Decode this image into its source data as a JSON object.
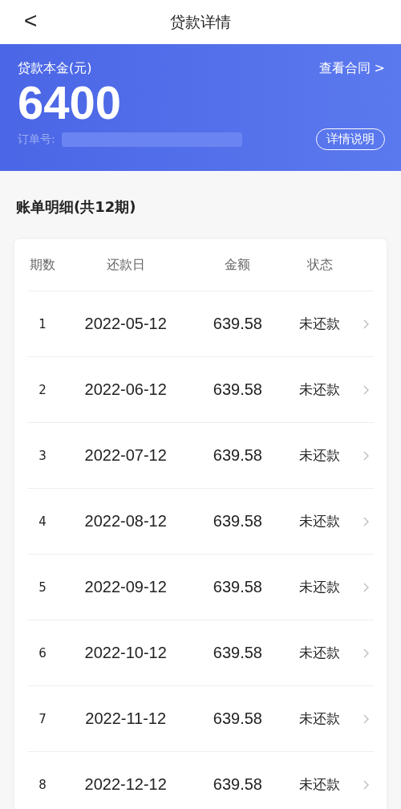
{
  "nav": {
    "back": "<",
    "title": "贷款详情"
  },
  "banner": {
    "label": "贷款本金(元)",
    "link": "查看合同 >",
    "amount": "6400",
    "order_label": "订单号:",
    "button": "详情说明"
  },
  "section_title": "账单明细(共12期)",
  "table": {
    "columns": [
      "期数",
      "还款日",
      "金额",
      "状态"
    ],
    "rows": [
      {
        "period": "1",
        "date": "2022-05-12",
        "amount": "639.58",
        "status": "未还款"
      },
      {
        "period": "2",
        "date": "2022-06-12",
        "amount": "639.58",
        "status": "未还款"
      },
      {
        "period": "3",
        "date": "2022-07-12",
        "amount": "639.58",
        "status": "未还款"
      },
      {
        "period": "4",
        "date": "2022-08-12",
        "amount": "639.58",
        "status": "未还款"
      },
      {
        "period": "5",
        "date": "2022-09-12",
        "amount": "639.58",
        "status": "未还款"
      },
      {
        "period": "6",
        "date": "2022-10-12",
        "amount": "639.58",
        "status": "未还款"
      },
      {
        "period": "7",
        "date": "2022-11-12",
        "amount": "639.58",
        "status": "未还款"
      },
      {
        "period": "8",
        "date": "2022-12-12",
        "amount": "639.58",
        "status": "未还款"
      }
    ]
  }
}
